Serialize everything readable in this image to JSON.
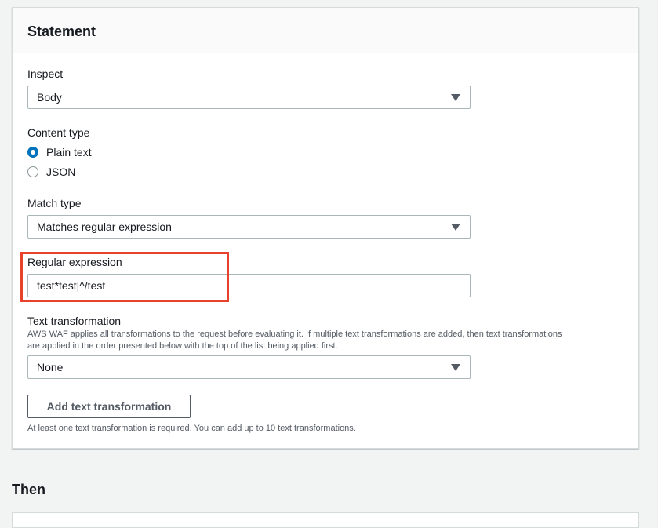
{
  "statement": {
    "title": "Statement",
    "inspect": {
      "label": "Inspect",
      "value": "Body"
    },
    "content_type": {
      "label": "Content type",
      "options": [
        {
          "label": "Plain text",
          "checked": true
        },
        {
          "label": "JSON",
          "checked": false
        }
      ]
    },
    "match_type": {
      "label": "Match type",
      "value": "Matches regular expression"
    },
    "regex": {
      "label": "Regular expression",
      "value": "test*test|^/test"
    },
    "text_transformation": {
      "label": "Text transformation",
      "description": "AWS WAF applies all transformations to the request before evaluating it. If multiple text transformations are added, then text transformations are applied in the order presented below with the top of the list being applied first.",
      "value": "None",
      "add_button": "Add text transformation",
      "hint": "At least one text transformation is required. You can add up to 10 text transformations."
    }
  },
  "then": {
    "title": "Then"
  },
  "colors": {
    "accent": "#0073bb",
    "highlight": "#e8412c"
  },
  "icons": {
    "select_caret": "caret-down-icon",
    "radio": "radio-icon"
  }
}
